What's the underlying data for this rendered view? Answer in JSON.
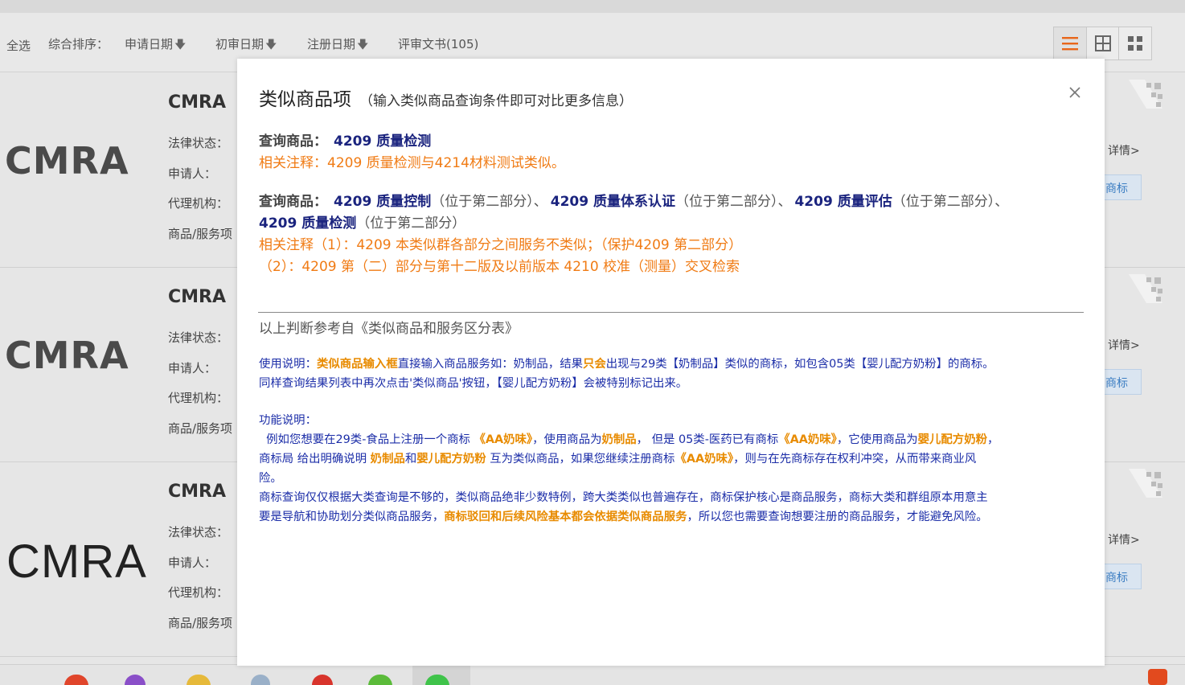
{
  "sortbar": {
    "select_all": "全选",
    "sort_label": "综合排序：",
    "apply_date": "申请日期",
    "prelim_date": "初审日期",
    "register_date": "注册日期",
    "review_docs": "评审文书(105)",
    "arrow": "🡇"
  },
  "cards": [
    {
      "logo": "CMRA",
      "title": "CMRA",
      "legal_status": "法律状态：",
      "applicant": "申请人：",
      "agency": "代理机构：",
      "goods": "商品/服务项",
      "detail": "详情>",
      "tm_button": "商标"
    },
    {
      "logo": "CMRA",
      "title": "CMRA",
      "legal_status": "法律状态：",
      "applicant": "申请人：",
      "agency": "代理机构：",
      "goods": "商品/服务项",
      "detail": "详情>",
      "tm_button": "商标"
    },
    {
      "logo": "CMRA",
      "title": "CMRA",
      "legal_status": "法律状态：",
      "applicant": "申请人：",
      "agency": "代理机构：",
      "goods": "商品/服务项",
      "detail": "详情>",
      "tm_button": "商标"
    }
  ],
  "modal": {
    "title": "类似商品项",
    "subtitle": "（输入类似商品查询条件即可对比更多信息）",
    "query_label": "查询商品：",
    "q1_goods": "4209 质量检测",
    "q1_note": "相关注释：4209 质量检测与4214材料测试类似。",
    "q2_goods": [
      {
        "name": "4209 质量控制",
        "pos": "（位于第二部分）、"
      },
      {
        "name": "4209 质量体系认证",
        "pos": "（位于第二部分）、"
      },
      {
        "name": "4209 质量评估",
        "pos": "（位于第二部分）、"
      },
      {
        "name": "4209 质量检测",
        "pos": "（位于第二部分）"
      }
    ],
    "q2_note1": "相关注释（1）：4209 本类似群各部分之间服务不类似；（保护4209 第二部分）",
    "q2_note2": "（2）：4209 第（二）部分与第十二版及以前版本 4210 校准（测量）交叉检索",
    "reference": "以上判断参考自《类似商品和服务区分表》",
    "usage": {
      "t1": "使用说明：",
      "h1": "类似商品输入框",
      "t2": "直接输入商品服务如：奶制品，结果",
      "h2": "只会",
      "t3": "出现与29类【奶制品】类似的商标，如包含05类【婴儿配方奶粉】的商标。",
      "t4": "同样查询结果列表中再次点击'类似商品'按钮，【婴儿配方奶粉】会被特别标记出来。"
    },
    "function": {
      "title": "功能说明：",
      "p1a": "  例如您想要在29类-食品上注册一个商标 ",
      "p1b": "《AA奶味》",
      "p1c": "，使用商品为",
      "p1d": "奶制品",
      "p1e": "， 但是 05类-医药已有商标",
      "p1f": "《AA奶味》",
      "p1g": "，它使用商品为",
      "p1h": "婴儿配方奶粉",
      "p1i": "，",
      "p2a": "商标局 给出明确说明 ",
      "p2b": "奶制品",
      "p2c": "和",
      "p2d": "婴儿配方奶粉",
      "p2e": " 互为类似商品，如果您继续注册商标",
      "p2f": "《AA奶味》",
      "p2g": "，则与在先商标存在权利冲突，从而带来商业风",
      "p3": "险。",
      "p4": "商标查询仅仅根据大类查询是不够的，类似商品绝非少数特例，跨大类类似也普遍存在，商标保护核心是商品服务，商标大类和群组原本用意主",
      "p5a": "要是导航和协助划分类似商品服务，",
      "p5b": "商标驳回和后续风险基本都会依据类似商品服务",
      "p5c": "，所以您也需要查询想要注册的商品服务，才能避免风险。"
    }
  },
  "colors": {
    "accent": "#e8661a",
    "navy": "#1a237e",
    "orange": "#f07b14",
    "blue_text": "#1c2ea8"
  }
}
